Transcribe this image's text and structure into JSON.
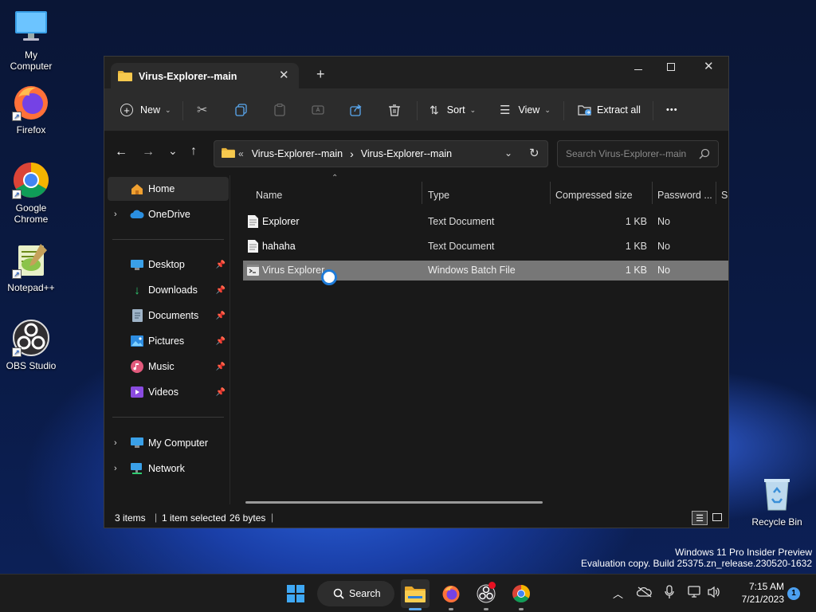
{
  "desktop": {
    "icons": [
      {
        "label": "My Computer",
        "icon": "monitor-icon"
      },
      {
        "label": "Firefox",
        "icon": "firefox-icon"
      },
      {
        "label": "Google Chrome",
        "icon": "chrome-icon"
      },
      {
        "label": "Notepad++",
        "icon": "notepadpp-icon"
      },
      {
        "label": "OBS Studio",
        "icon": "obs-icon"
      }
    ],
    "recycle_bin": "Recycle Bin",
    "watermark_line1": "Windows 11 Pro Insider Preview",
    "watermark_line2": "Evaluation copy. Build 25375.zn_release.230520-1632"
  },
  "window": {
    "tab_title": "Virus-Explorer--main",
    "new_tab": "+",
    "toolbar": {
      "new": "New",
      "sort": "Sort",
      "view": "View",
      "extract_all": "Extract all",
      "more": "•••"
    },
    "address": {
      "overflow": "«",
      "crumb1": "Virus-Explorer--main",
      "crumb2": "Virus-Explorer--main",
      "sep": "›"
    },
    "search_placeholder": "Search Virus-Explorer--main",
    "nav": {
      "home": "Home",
      "onedrive": "OneDrive",
      "quick": [
        "Desktop",
        "Downloads",
        "Documents",
        "Pictures",
        "Music",
        "Videos"
      ],
      "mycomputer": "My Computer",
      "network": "Network"
    },
    "columns": {
      "name": "Name",
      "type": "Type",
      "compressed": "Compressed size",
      "password": "Password ...",
      "size": "Si"
    },
    "files": [
      {
        "name": "Explorer",
        "type": "Text Document",
        "compressed": "1 KB",
        "password": "No",
        "selected": false
      },
      {
        "name": "hahaha",
        "type": "Text Document",
        "compressed": "1 KB",
        "password": "No",
        "selected": false
      },
      {
        "name": "Virus Explorer",
        "type": "Windows Batch File",
        "compressed": "1 KB",
        "password": "No",
        "selected": true
      }
    ],
    "status": {
      "items": "3 items",
      "selected": "1 item selected",
      "bytes": "26 bytes",
      "divider": "|"
    }
  },
  "taskbar": {
    "search": "Search",
    "time": "7:15 AM",
    "date": "7/21/2023",
    "notification_count": "1"
  },
  "colors": {
    "accent": "#0078d4",
    "window_bg": "#191919",
    "toolbar_bg": "#2c2c2c",
    "selection": "#777777"
  }
}
